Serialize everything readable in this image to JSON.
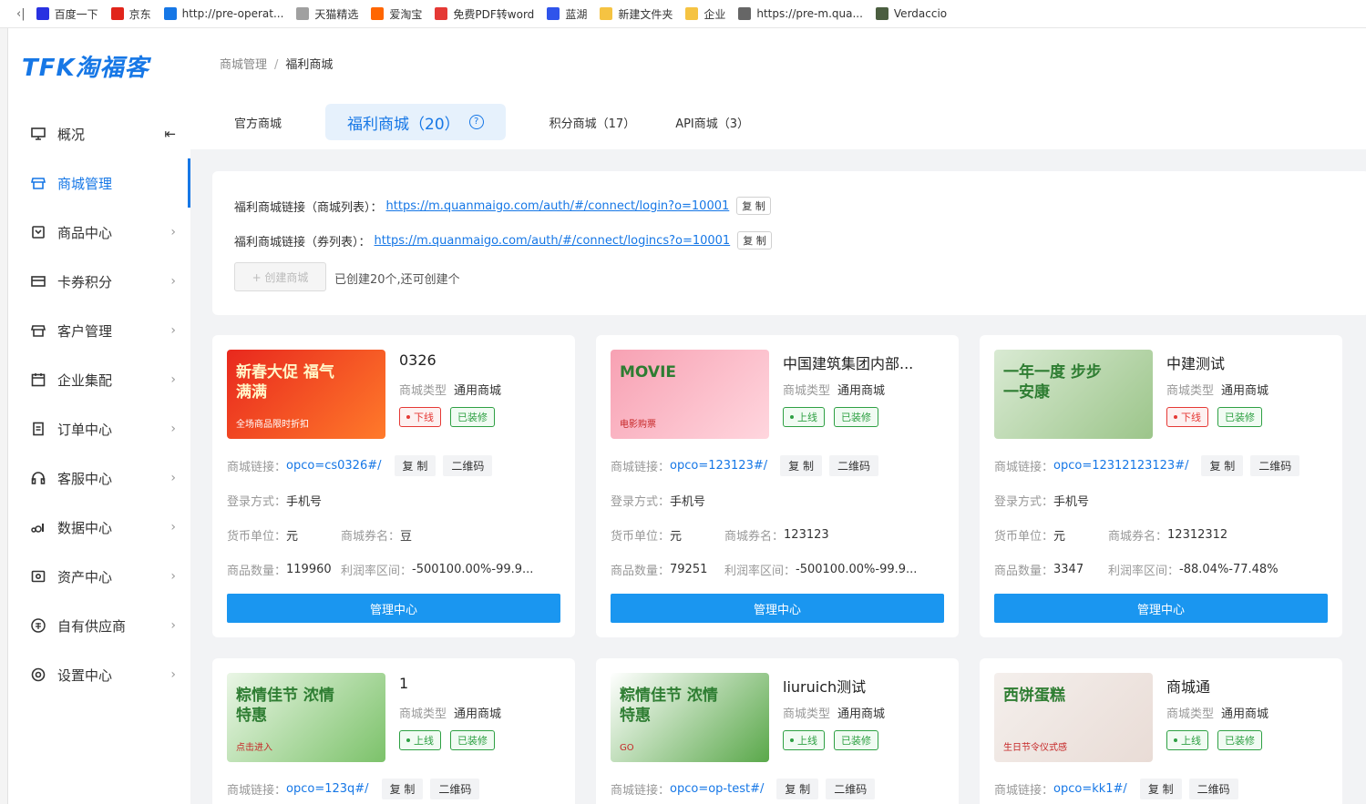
{
  "bookmarks": [
    {
      "label": "百度一下",
      "icon": "baidu-icon",
      "color": "#2932e1"
    },
    {
      "label": "京东",
      "icon": "jd-icon",
      "color": "#e1251b"
    },
    {
      "label": "http://pre-operat...",
      "icon": "globe-icon",
      "color": "#1677e6"
    },
    {
      "label": "天猫精选",
      "icon": "tmall-icon",
      "color": "#a0a0a0"
    },
    {
      "label": "爱淘宝",
      "icon": "taobao-icon",
      "color": "#ff6600"
    },
    {
      "label": "免费PDF转word",
      "icon": "pdf-icon",
      "color": "#e53935"
    },
    {
      "label": "蓝湖",
      "icon": "lanhu-icon",
      "color": "#2f54eb"
    },
    {
      "label": "新建文件夹",
      "icon": "folder-icon",
      "color": "#f5c342"
    },
    {
      "label": "企业",
      "icon": "folder-icon",
      "color": "#f5c342"
    },
    {
      "label": "https://pre-m.qua...",
      "icon": "globe-icon",
      "color": "#666666"
    },
    {
      "label": "Verdaccio",
      "icon": "verdaccio-icon",
      "color": "#4b5e40"
    }
  ],
  "logo": "TFK淘福客",
  "sidebar": {
    "items": [
      {
        "label": "概况",
        "icon": "monitor-icon",
        "name": "overview"
      },
      {
        "label": "商城管理",
        "icon": "shop-icon",
        "name": "mall-management",
        "active": true
      },
      {
        "label": "商品中心",
        "icon": "product-icon",
        "name": "product-center"
      },
      {
        "label": "卡券积分",
        "icon": "card-icon",
        "name": "coupon-points"
      },
      {
        "label": "客户管理",
        "icon": "customer-icon",
        "name": "customer-management"
      },
      {
        "label": "企业集配",
        "icon": "calendar-icon",
        "name": "enterprise-distribution"
      },
      {
        "label": "订单中心",
        "icon": "order-icon",
        "name": "order-center"
      },
      {
        "label": "客服中心",
        "icon": "headset-icon",
        "name": "service-center"
      },
      {
        "label": "数据中心",
        "icon": "data-icon",
        "name": "data-center"
      },
      {
        "label": "资产中心",
        "icon": "asset-icon",
        "name": "asset-center"
      },
      {
        "label": "自有供应商",
        "icon": "supplier-icon",
        "name": "own-supplier"
      },
      {
        "label": "设置中心",
        "icon": "settings-icon",
        "name": "settings-center"
      }
    ]
  },
  "breadcrumb": {
    "parent": "商城管理",
    "separator": "/",
    "current": "福利商城"
  },
  "tabs": [
    {
      "label": "官方商城"
    },
    {
      "label": "福利商城（20）",
      "active": true
    },
    {
      "label": "积分商城（17）"
    },
    {
      "label": "API商城（3）"
    }
  ],
  "links": {
    "mall_list_label": "福利商城链接（商城列表）：",
    "mall_list_url": "https://m.quanmaigo.com/auth/#/connect/login?o=10001",
    "coupon_list_label": "福利商城链接（券列表）：",
    "coupon_list_url": "https://m.quanmaigo.com/auth/#/connect/logincs?o=10001",
    "copy_label": "复 制",
    "create_label": "+ 创建商城",
    "create_note": "已创建20个,还可创建个"
  },
  "labels": {
    "type": "商城类型",
    "link": "商城链接：",
    "login": "登录方式：",
    "currency": "货币单位：",
    "coupon_name": "商城券名：",
    "goods_count": "商品数量：",
    "profit_range": "利润率区间：",
    "copy": "复 制",
    "qrcode": "二维码",
    "manage": "管理中心",
    "decorated": "已装修"
  },
  "cards": [
    {
      "title": "0326",
      "type": "通用商城",
      "status": "下线",
      "status_kind": "offline",
      "link": "opco=cs0326#/",
      "login": "手机号",
      "currency": "元",
      "coupon_name": "豆",
      "goods_count": "119960",
      "profit_range": "-500100.00%-99.9...",
      "thumb_text": "新春大促 福气满满",
      "thumb_sub": "全场商品限时折扣",
      "thumb_colors": [
        "#e8281e",
        "#ff7a2a"
      ]
    },
    {
      "title": "中国建筑集团内部...",
      "type": "通用商城",
      "status": "上线",
      "status_kind": "online",
      "link": "opco=123123#/",
      "login": "手机号",
      "currency": "元",
      "coupon_name": "123123",
      "goods_count": "79251",
      "profit_range": "-500100.00%-99.9...",
      "thumb_text": "MOVIE",
      "thumb_sub": "电影购票",
      "thumb_colors": [
        "#f7a1b3",
        "#ffd6de"
      ]
    },
    {
      "title": "中建测试",
      "type": "通用商城",
      "status": "下线",
      "status_kind": "offline",
      "link": "opco=12312123123#/",
      "login": "手机号",
      "currency": "元",
      "coupon_name": "12312312",
      "goods_count": "3347",
      "profit_range": "-88.04%-77.48%",
      "thumb_text": "一年一度 步步一安康",
      "thumb_sub": "",
      "thumb_colors": [
        "#d9ead3",
        "#9cc58a"
      ]
    },
    {
      "title": "1",
      "type": "通用商城",
      "status": "上线",
      "status_kind": "online",
      "link": "opco=123q#/",
      "thumb_text": "粽情佳节 浓情特惠",
      "thumb_sub": "点击进入",
      "thumb_colors": [
        "#eaf6e6",
        "#7cc26a"
      ]
    },
    {
      "title": "liuruich测试",
      "type": "通用商城",
      "status": "上线",
      "status_kind": "online",
      "link": "opco=op-test#/",
      "thumb_text": "粽情佳节 浓情特惠",
      "thumb_sub": "GO",
      "thumb_colors": [
        "#ffffff",
        "#5aa84a"
      ]
    },
    {
      "title": "商城通",
      "type": "通用商城",
      "status": "上线",
      "status_kind": "online",
      "link": "opco=kk1#/",
      "thumb_text": "西饼蛋糕",
      "thumb_sub": "生日节令仪式感",
      "thumb_colors": [
        "#f4efec",
        "#e9dcd6"
      ]
    }
  ]
}
